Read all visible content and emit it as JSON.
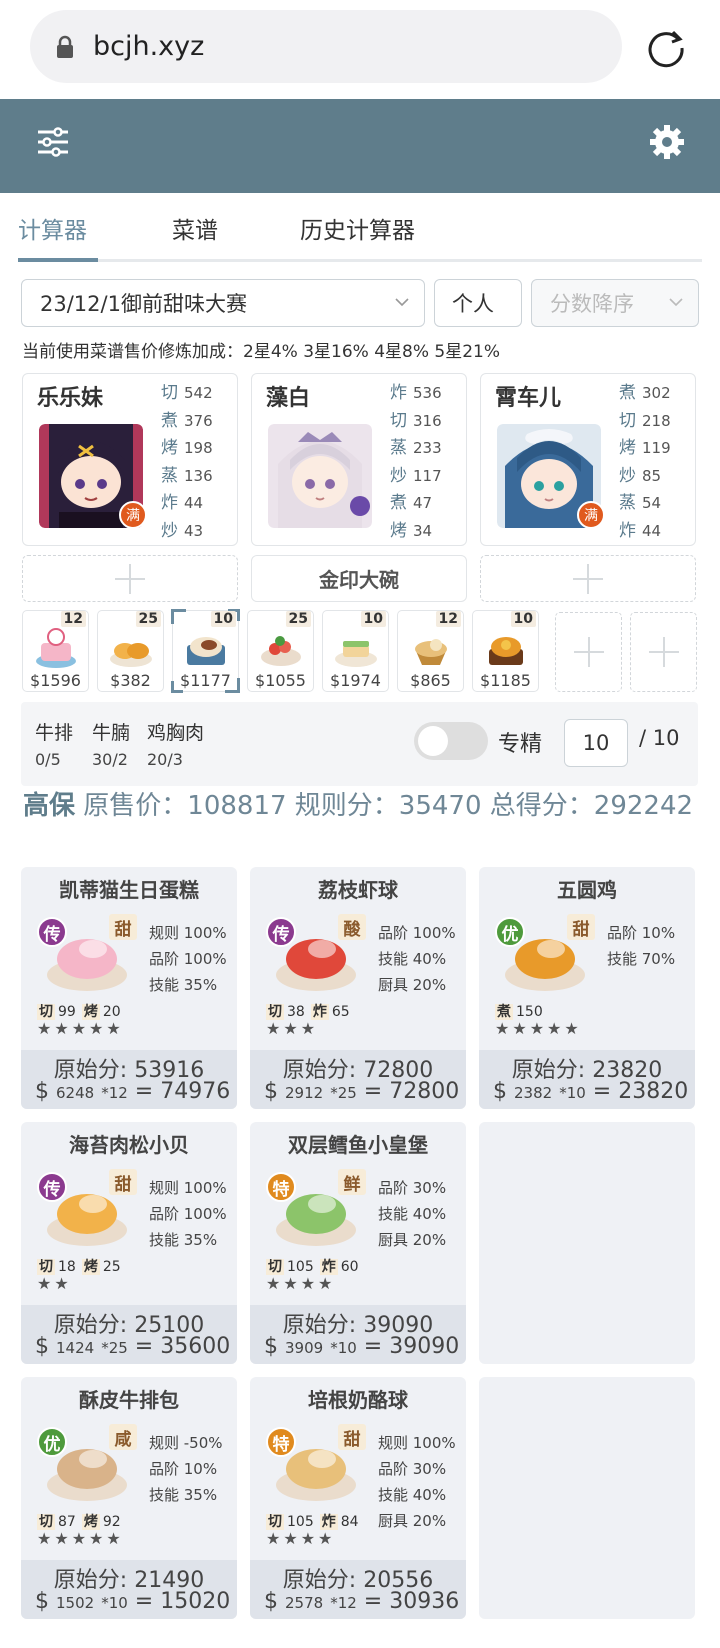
{
  "browser": {
    "url": "bcjh.xyz"
  },
  "tabs": [
    {
      "label": "计算器"
    },
    {
      "label": "菜谱"
    },
    {
      "label": "历史计算器"
    }
  ],
  "controls": {
    "contest": "23/12/1御前甜味大赛",
    "mode": "个人",
    "sort_placeholder": "分数降序"
  },
  "info_line": "当前使用菜谱售价修炼加成：2星4% 3星16% 4星8% 5星21%",
  "chefs": [
    {
      "name": "乐乐妹",
      "badge": "满",
      "stats": [
        {
          "k": "切",
          "v": "542"
        },
        {
          "k": "煮",
          "v": "376"
        },
        {
          "k": "烤",
          "v": "198"
        },
        {
          "k": "蒸",
          "v": "136"
        },
        {
          "k": "炸",
          "v": "44"
        },
        {
          "k": "炒",
          "v": "43"
        }
      ]
    },
    {
      "name": "藻白",
      "badge": "",
      "stats": [
        {
          "k": "炸",
          "v": "536"
        },
        {
          "k": "切",
          "v": "316"
        },
        {
          "k": "蒸",
          "v": "233"
        },
        {
          "k": "炒",
          "v": "117"
        },
        {
          "k": "煮",
          "v": "47"
        },
        {
          "k": "烤",
          "v": "34"
        }
      ]
    },
    {
      "name": "霄车儿",
      "badge": "满",
      "stats": [
        {
          "k": "煮",
          "v": "302"
        },
        {
          "k": "切",
          "v": "218"
        },
        {
          "k": "烤",
          "v": "119"
        },
        {
          "k": "炒",
          "v": "85"
        },
        {
          "k": "蒸",
          "v": "54"
        },
        {
          "k": "炸",
          "v": "44"
        }
      ]
    }
  ],
  "equip": {
    "label": "金印大碗"
  },
  "dishes": [
    {
      "count": "12",
      "price": "$1596",
      "color": "#f5b6c8"
    },
    {
      "count": "25",
      "price": "$382",
      "color": "#f2b24a"
    },
    {
      "count": "10",
      "price": "$1177",
      "color": "#d9b38a"
    },
    {
      "count": "25",
      "price": "$1055",
      "color": "#e0483a"
    },
    {
      "count": "10",
      "price": "$1974",
      "color": "#8cc46a"
    },
    {
      "count": "12",
      "price": "$865",
      "color": "#e8c07a"
    },
    {
      "count": "10",
      "price": "$1185",
      "color": "#e89a2a"
    }
  ],
  "materials": [
    {
      "name": "牛排",
      "count": "0/5"
    },
    {
      "name": "牛腩",
      "count": "30/2"
    },
    {
      "name": "鸡胸肉",
      "count": "20/3"
    }
  ],
  "specialize": {
    "label": "专精",
    "value": "10",
    "max": "/ 10"
  },
  "summary": {
    "name": "高保",
    "text": "原售价：108817 规则分：35470 总得分：292242"
  },
  "recipes": [
    {
      "title": "凯蒂猫生日蛋糕",
      "rarity": "传",
      "rarity_color": "#8b3a8f",
      "flavor": "甜",
      "bonus": [
        "规则 100%",
        "品阶 100%",
        "技能 35%"
      ],
      "skills": [
        {
          "k": "切",
          "v": "99"
        },
        {
          "k": "烤",
          "v": "20"
        }
      ],
      "stars": "★★★★★",
      "orig": "原始分: 53916",
      "price": "6248",
      "mult": "*12",
      "total": "74976",
      "color": "#f5b6c8"
    },
    {
      "title": "荔枝虾球",
      "rarity": "传",
      "rarity_color": "#8b3a8f",
      "flavor": "酸",
      "bonus": [
        "品阶 100%",
        "技能 40%",
        "厨具 20%"
      ],
      "skills": [
        {
          "k": "切",
          "v": "38"
        },
        {
          "k": "炸",
          "v": "65"
        }
      ],
      "stars": "★★★",
      "orig": "原始分: 72800",
      "price": "2912",
      "mult": "*25",
      "total": "72800",
      "color": "#e0483a"
    },
    {
      "title": "五圆鸡",
      "rarity": "优",
      "rarity_color": "#4e9a3c",
      "flavor": "甜",
      "bonus": [
        "品阶 10%",
        "技能 70%"
      ],
      "skills": [
        {
          "k": "煮",
          "v": "150"
        }
      ],
      "stars": "★★★★★",
      "orig": "原始分: 23820",
      "price": "2382",
      "mult": "*10",
      "total": "23820",
      "color": "#e89a2a"
    },
    {
      "title": "海苔肉松小贝",
      "rarity": "传",
      "rarity_color": "#8b3a8f",
      "flavor": "甜",
      "bonus": [
        "规则 100%",
        "品阶 100%",
        "技能 35%"
      ],
      "skills": [
        {
          "k": "切",
          "v": "18"
        },
        {
          "k": "烤",
          "v": "25"
        }
      ],
      "stars": "★★",
      "orig": "原始分: 25100",
      "price": "1424",
      "mult": "*25",
      "total": "35600",
      "color": "#f2b24a"
    },
    {
      "title": "双层鳕鱼小皇堡",
      "rarity": "特",
      "rarity_color": "#e08a1e",
      "flavor": "鲜",
      "bonus": [
        "品阶 30%",
        "技能 40%",
        "厨具 20%"
      ],
      "skills": [
        {
          "k": "切",
          "v": "105"
        },
        {
          "k": "炸",
          "v": "60"
        }
      ],
      "stars": "★★★★",
      "orig": "原始分: 39090",
      "price": "3909",
      "mult": "*10",
      "total": "39090",
      "color": "#8cc46a"
    },
    {
      "title": "酥皮牛排包",
      "rarity": "优",
      "rarity_color": "#4e9a3c",
      "flavor": "咸",
      "bonus": [
        "规则 -50%",
        "品阶 10%",
        "技能 35%"
      ],
      "skills": [
        {
          "k": "切",
          "v": "87"
        },
        {
          "k": "烤",
          "v": "92"
        }
      ],
      "stars": "★★★★★",
      "orig": "原始分: 21490",
      "price": "1502",
      "mult": "*10",
      "total": "15020",
      "color": "#d9b38a"
    },
    {
      "title": "培根奶酪球",
      "rarity": "特",
      "rarity_color": "#e08a1e",
      "flavor": "甜",
      "bonus": [
        "规则 100%",
        "品阶 30%",
        "技能 40%",
        "厨具 20%"
      ],
      "skills": [
        {
          "k": "切",
          "v": "105"
        },
        {
          "k": "炸",
          "v": "84"
        }
      ],
      "stars": "★★★★",
      "orig": "原始分: 20556",
      "price": "2578",
      "mult": "*12",
      "total": "30936",
      "color": "#e8c07a"
    }
  ],
  "colors": {
    "appbar": "#5f7d8b",
    "accent": "#6b8ca0",
    "card_bg": "#eff1f5"
  }
}
